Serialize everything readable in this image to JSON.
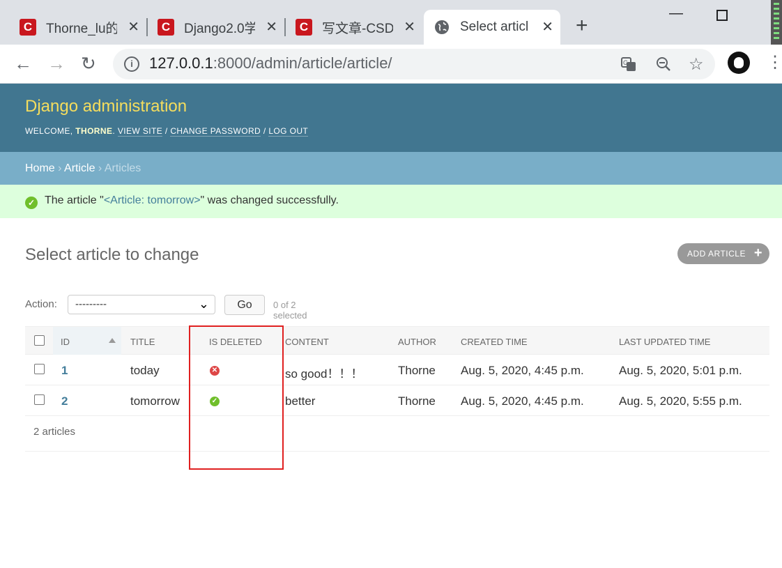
{
  "browser": {
    "tabs": [
      {
        "favicon": "C",
        "label": "Thorne_lu的",
        "close": "✕"
      },
      {
        "favicon": "C",
        "label": "Django2.0学",
        "close": "✕"
      },
      {
        "favicon": "C",
        "label": "写文章-CSDI",
        "close": "✕"
      },
      {
        "favicon": "globe-icon",
        "label": "Select articl",
        "close": "✕"
      }
    ],
    "new_tab": "+",
    "url_host": "127.0.0.1",
    "url_path": ":8000/admin/article/article/"
  },
  "header": {
    "brand": "Django administration",
    "welcome": "Welcome, ",
    "user": "Thorne",
    "view_site": "View site",
    "change_password": "Change password",
    "log_out": "Log out"
  },
  "breadcrumbs": {
    "home": "Home",
    "app": "Article",
    "current": "Articles"
  },
  "message": {
    "prefix": "The article \"",
    "link": "<Article: tomorrow>",
    "suffix": "\" was changed successfully."
  },
  "page": {
    "title": "Select article to change",
    "add_button": "Add article"
  },
  "actions": {
    "label": "Action:",
    "selected_option": "---------",
    "go": "Go",
    "selection_count": "0 of 2 selected"
  },
  "table": {
    "headers": [
      "ID",
      "Title",
      "Is deleted",
      "Content",
      "Author",
      "Created time",
      "Last updated time"
    ],
    "rows": [
      {
        "id": "1",
        "title": "today",
        "is_deleted": false,
        "content": "so good！！！",
        "author": "Thorne",
        "created": "Aug. 5, 2020, 4:45 p.m.",
        "updated": "Aug. 5, 2020, 5:01 p.m."
      },
      {
        "id": "2",
        "title": "tomorrow",
        "is_deleted": true,
        "content": "better",
        "author": "Thorne",
        "created": "Aug. 5, 2020, 4:45 p.m.",
        "updated": "Aug. 5, 2020, 5:55 p.m."
      }
    ],
    "count": "2 articles"
  },
  "colors": {
    "header_bg": "#417690",
    "brand": "#f5dd5d",
    "breadcrumb_bg": "#79aec8",
    "success_bg": "#ddffdd",
    "highlight_box": "#e02020"
  }
}
